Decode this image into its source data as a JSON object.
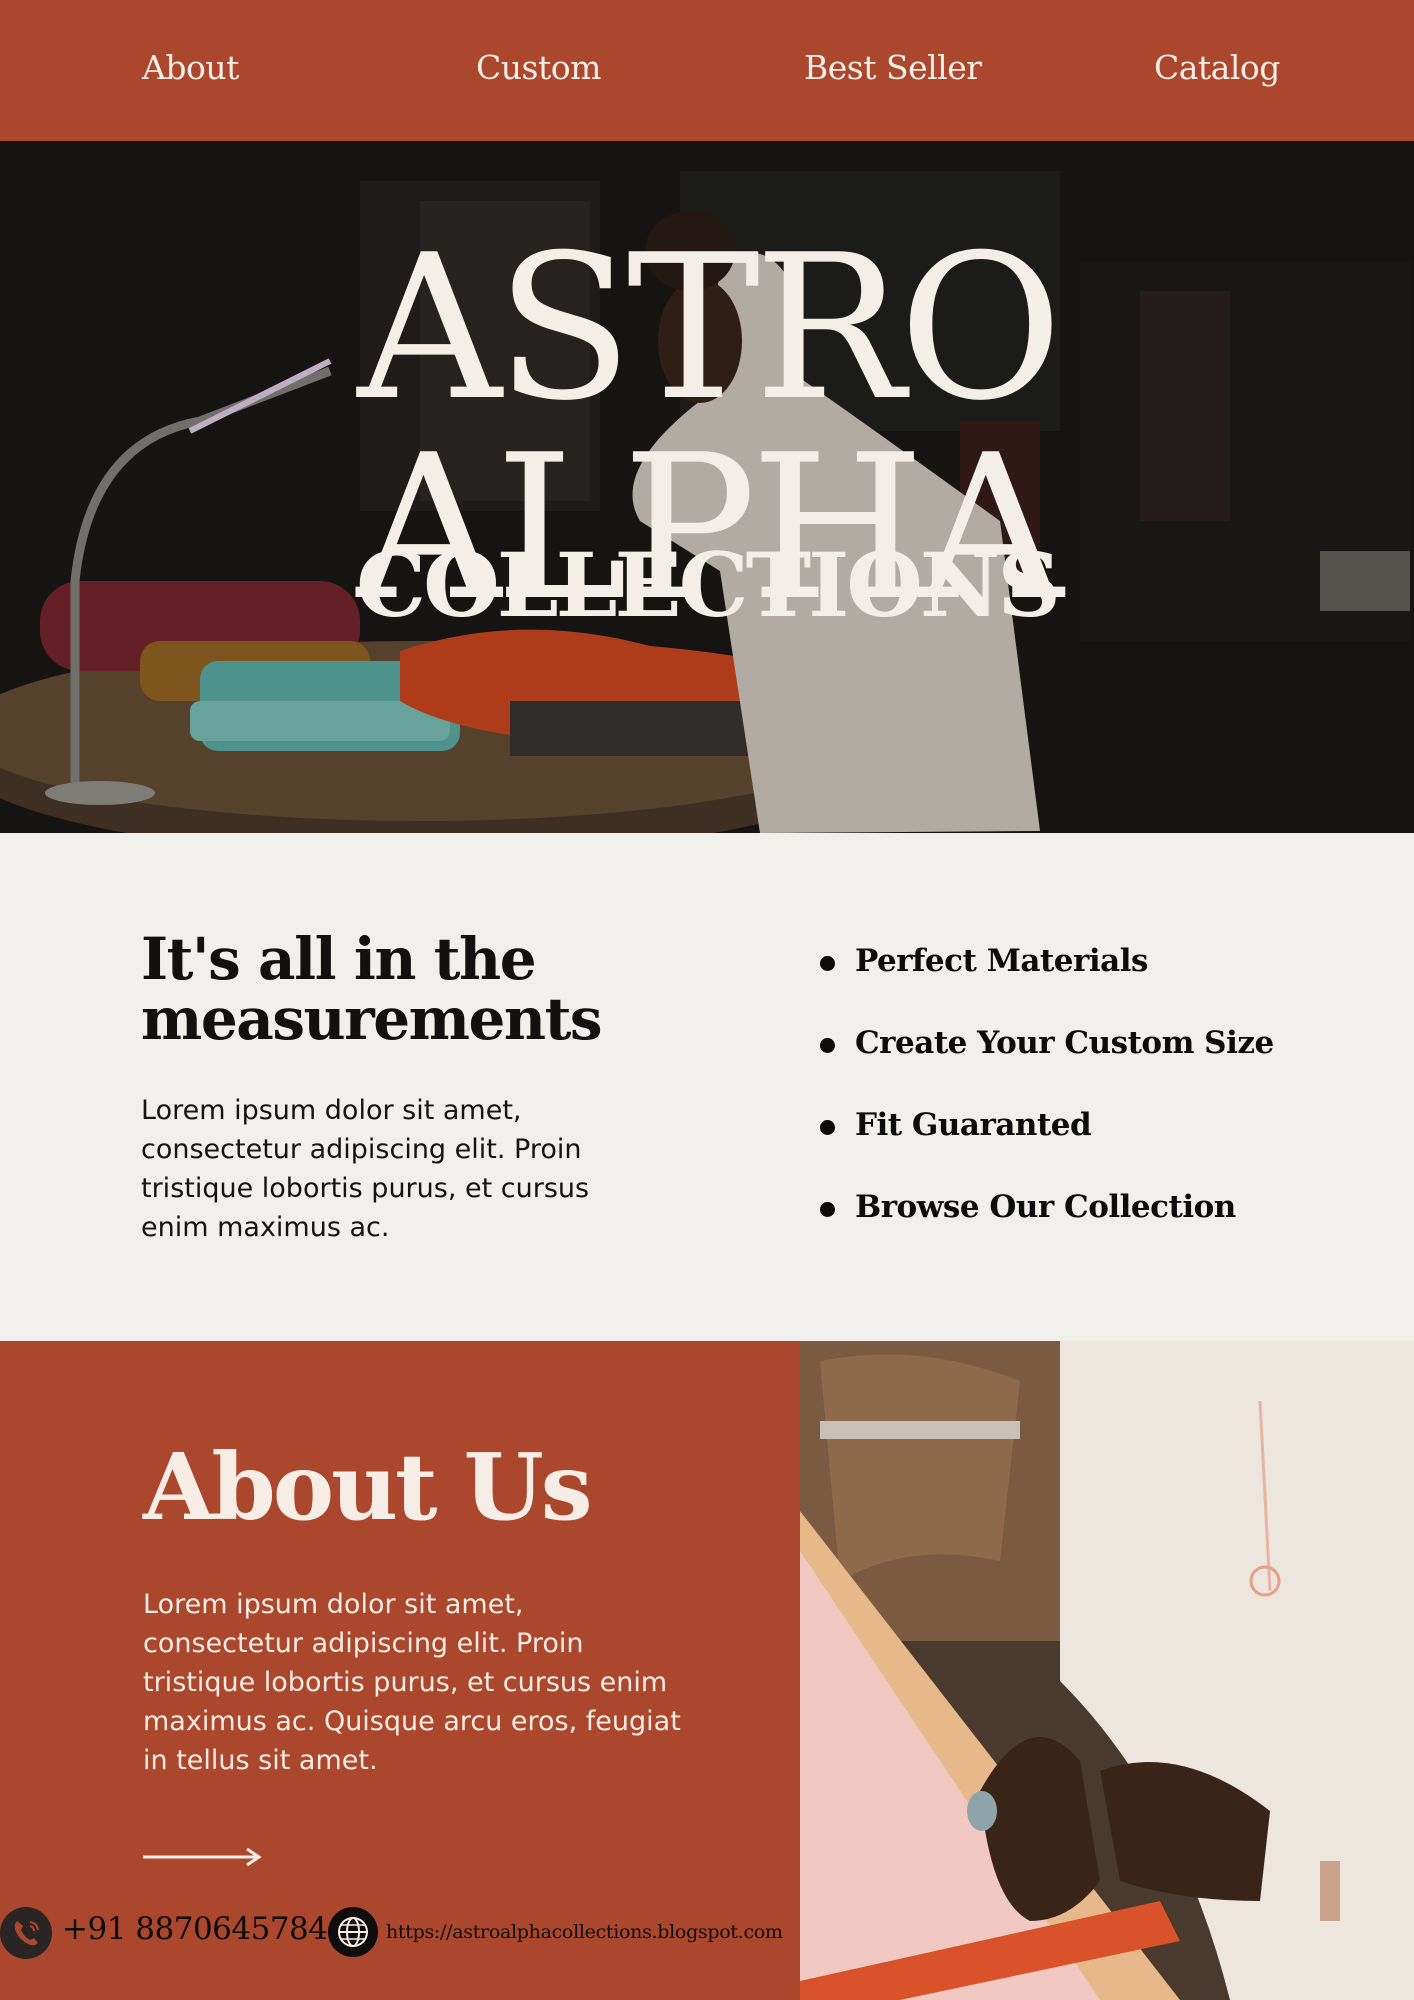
{
  "nav": {
    "items": [
      "About",
      "Custom",
      "Best Seller",
      "Catalog"
    ]
  },
  "hero": {
    "title": "ASTRO ALPHA",
    "subtitle": "COLLECTIONS"
  },
  "measurements": {
    "heading": "It's all in the measurements",
    "body": "Lorem ipsum dolor sit amet, consectetur adipiscing elit. Proin tristique lobortis purus, et cursus enim maximus ac.",
    "features": [
      "Perfect Materials",
      "Create Your Custom Size",
      "Fit Guaranted",
      "Browse Our Collection"
    ]
  },
  "about": {
    "title": "About Us",
    "body": "Lorem ipsum dolor sit amet, consectetur adipiscing elit. Proin tristique lobortis purus, et cursus enim maximus ac. Quisque arcu eros, feugiat in tellus sit amet."
  },
  "contact": {
    "phone": "+91 8870645784",
    "url": "https://astroalphacollections.blogspot.com"
  },
  "icons": {
    "arrow": "arrow-right-icon",
    "phone": "phone-icon",
    "globe": "globe-icon"
  },
  "colors": {
    "brand": "#ab472d",
    "cream": "#f2f0ec",
    "text_dark": "#121010",
    "text_light": "#f6ede6"
  }
}
